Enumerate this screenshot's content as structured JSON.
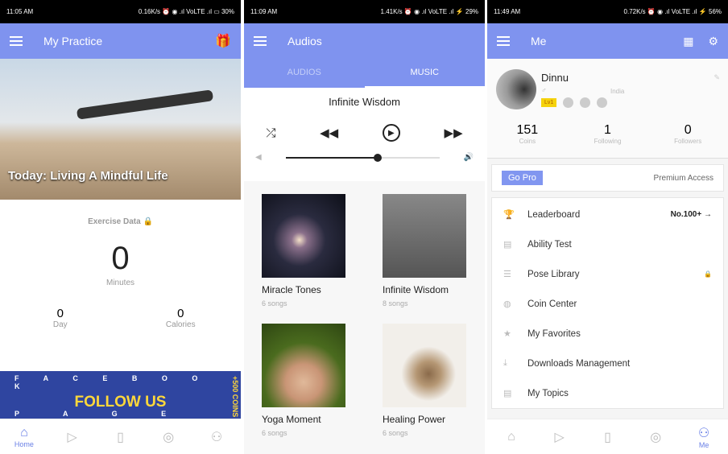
{
  "panels": [
    {
      "status": {
        "time": "11:05 AM",
        "right": "0.16K/s ⏰ ◉ .ıl VoLTE .ıl ▭ 30%"
      },
      "title": "My Practice",
      "hero": "Today: Living A Mindful Life",
      "exercise_label": "Exercise Data",
      "minutes": "0",
      "minutes_label": "Minutes",
      "day": "0",
      "day_label": "Day",
      "calories": "0",
      "calories_label": "Calories",
      "banner": {
        "top": "F A C E B O O K",
        "main": "FOLLOW US",
        "bottom": "P A G E",
        "side": "+500 COINS"
      }
    },
    {
      "status": {
        "time": "11:09 AM",
        "right": "1.41K/s ⏰ ◉ .ıl VoLTE .ıl ⚡ 29%"
      },
      "title": "Audios",
      "tabs": [
        "AUDIOS",
        "MUSIC"
      ],
      "now_playing": "Infinite Wisdom",
      "progress": 0.6,
      "albums": [
        {
          "title": "Miracle Tones",
          "songs": "6 songs"
        },
        {
          "title": "Infinite Wisdom",
          "songs": "8 songs"
        },
        {
          "title": "Yoga Moment",
          "songs": "6 songs"
        },
        {
          "title": "Healing Power",
          "songs": "6 songs"
        }
      ]
    },
    {
      "status": {
        "time": "11:49 AM",
        "right": "0.72K/s ⏰ ◉ .ıl VoLTE .ıl ⚡ 56%"
      },
      "title": "Me",
      "name": "Dinnu",
      "gender": "♂",
      "country": "India",
      "level": "Lv1",
      "stats": [
        {
          "v": "151",
          "l": "Coins"
        },
        {
          "v": "1",
          "l": "Following"
        },
        {
          "v": "0",
          "l": "Followers"
        }
      ],
      "go_pro": "Go Pro",
      "premium": "Premium Access",
      "menu": [
        {
          "label": "Leaderboard",
          "right": "No.100+ →"
        },
        {
          "label": "Ability Test"
        },
        {
          "label": "Pose Library",
          "right": "🔒"
        },
        {
          "label": "Coin Center"
        },
        {
          "label": "My Favorites"
        },
        {
          "label": "Downloads Management"
        },
        {
          "label": "My Topics"
        }
      ]
    }
  ],
  "nav": {
    "home": "Home",
    "me": "Me"
  },
  "colors": {
    "accent": "#7f93ef"
  }
}
